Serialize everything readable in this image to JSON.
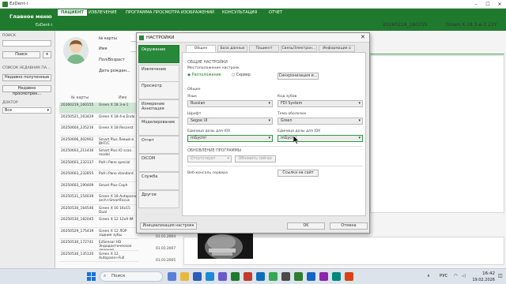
{
  "window": {
    "title": "EzDent-i",
    "controls": [
      "–",
      "☐",
      "✕"
    ]
  },
  "header": {
    "brand": "Главное меню",
    "brand_sub": "EzDent-i",
    "tabs": [
      "ПАЦИЕНТ",
      "ИЗВЛЕЧЕНИЕ",
      "ПРОГРАММА ПРОСМОТРА ИЗОБРАЖЕНИЙ",
      "КОНСУЛЬТАЦИЯ",
      "ОТЧЕТ"
    ],
    "active_tab": "ПАЦИЕНТ"
  },
  "sidebar": {
    "search_label": "ПОИСК",
    "search_button": "Поиск",
    "recent_label": "СПИСОК НЕДАВНИХ ПА...",
    "recent_buttons": [
      "Недавно полученные",
      "Недавно просмотрен..."
    ],
    "doctor_label": "ДОКТОР",
    "doctor_value": "Все"
  },
  "patient_form": {
    "labels": [
      "№ карты",
      "Имя",
      "Пол/Возраст",
      "Дата рожден..."
    ],
    "list_headers": [
      "№ карты",
      "Имя"
    ],
    "rows": [
      {
        "id": "20260219_160155",
        "name": "Green X 18 3-в-1"
      },
      {
        "id": "20250521_163429",
        "name": "Green X 18 4-в Endo"
      },
      {
        "id": "20250604_235216",
        "name": "Green X 18 Reconst"
      },
      {
        "id": "20250606_002902",
        "name": "Smart Plus Левый в BHT/C"
      },
      {
        "id": "20250603_211436",
        "name": "Smart Plus IO scan. model"
      },
      {
        "id": "20250603_232337",
        "name": "PaX-i Pano special"
      },
      {
        "id": "20250603_232855",
        "name": "PaX-i Pano standard"
      },
      {
        "id": "20250603_190409",
        "name": "Smart Plus Ceph"
      },
      {
        "id": "20250531_154039",
        "name": "Green X 18 Autopano arch+SmartFocus"
      },
      {
        "id": "20250530_164546",
        "name": "Green X 16 16x15 Dual"
      },
      {
        "id": "20250530_182045",
        "name": "Green X 12 12x9 IM"
      },
      {
        "id": "20250529_175439",
        "name": "Green X 12 ЛОР задние зубы"
      },
      {
        "id": "20250530_172741",
        "name": "EzSensor HD Эндодонтическое лечение..."
      },
      {
        "id": "20250530_135120",
        "name": "Green X 12 Autopano+Full"
      }
    ],
    "dates": [
      "01.01.2004",
      "01.01.2007",
      "01.01.2005"
    ]
  },
  "right_panel": {
    "case_id": "20260219_160155",
    "model": "Green X 18 3-в-1 22Y"
  },
  "dialog": {
    "title": "НАСТРОЙКИ",
    "nav": [
      "Окружение",
      "Извлечение",
      "Просмотр",
      "Измерение Аннотация",
      "Моделирование",
      "Отчет",
      "DICOM",
      "Служба",
      "Другое"
    ],
    "active_nav": "Окружение",
    "tabs": [
      "Общее",
      "База данных",
      "Пациент",
      "Связь/Электрон...",
      "Информация о к..."
    ],
    "active_tab": "Общее",
    "general_section": "ОБЩИЕ НАСТРОЙКИ",
    "location_label": "Местоположение настроек",
    "location_options": [
      "Расположение",
      "Сервер"
    ],
    "sync_button": "Синхронизация и...",
    "common_label": "Общее",
    "language_label": "Язык",
    "language_value": "Russian",
    "tooth_label": "Код зубов",
    "tooth_value": "FDI System",
    "font_label": "Шрифт",
    "font_value": "Segoe UI",
    "theme_label": "Тема оболочки",
    "theme_value": "Green",
    "dose_label1": "Единица дозы для IOX",
    "dose_value1": "mGycm²",
    "dose_label2": "Единица дозы для IOX",
    "dose_value2": "mGycm²",
    "update_section": "ОБНОВЛЕНИЕ ПРОГРАММЫ",
    "update_value": "Отсутствует",
    "update_button": "Обновить сейчас",
    "web_label": "Веб-консоль сервера",
    "web_button": "Ссылка на сайт",
    "init_button": "Инициализация настроек",
    "ok_button": "OK",
    "cancel_button": "Отмена"
  },
  "taskbar": {
    "search_placeholder": "Поиск",
    "lang": "РУС",
    "time": "16:42",
    "date": "19.02.2026"
  }
}
